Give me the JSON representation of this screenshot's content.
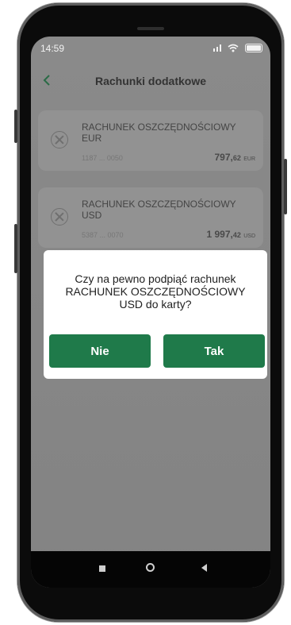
{
  "status_bar": {
    "time": "14:59",
    "signal_icon": "signal-icon",
    "wifi_icon": "wifi-icon",
    "battery_icon": "battery-icon"
  },
  "header": {
    "back_icon": "chevron-left-icon",
    "title": "Rachunki dodatkowe"
  },
  "accounts": [
    {
      "name": "RACHUNEK OSZCZĘDNOŚCIOWY EUR",
      "number": "1187 ... 0050",
      "balance_int": "797,",
      "balance_dec": "62",
      "currency": "EUR"
    },
    {
      "name": "RACHUNEK OSZCZĘDNOŚCIOWY USD",
      "number": "5387 ... 0070",
      "balance_int": "1 997,",
      "balance_dec": "42",
      "currency": "USD"
    }
  ],
  "dialog": {
    "message": "Czy na pewno podpiąć rachunek RACHUNEK OSZCZĘDNOŚCIOWY USD do karty?",
    "no_label": "Nie",
    "yes_label": "Tak"
  },
  "colors": {
    "accent_green": "#1f7a4a",
    "overlay": "#8a8a8a"
  }
}
